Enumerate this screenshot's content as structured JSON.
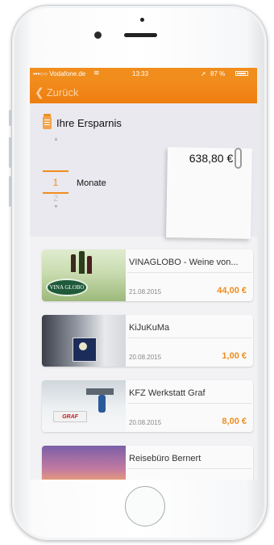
{
  "statusbar": {
    "carrier": "•••○○ Vodafone.de",
    "wifi_icon": "wifi-icon",
    "time": "13:33",
    "battery": "87 %"
  },
  "navbar": {
    "back_label": "Zurück"
  },
  "savings": {
    "title": "Ihre Ersparnis",
    "picker_selected": "1",
    "picker_next": "2",
    "unit_label": "Monate",
    "amount": "638,80 €"
  },
  "items": [
    {
      "title": "VINAGLOBO - Weine von...",
      "date": "21.08.2015",
      "price": "44,00 €",
      "logo_text": "VINA GLOBO"
    },
    {
      "title": "KiJuKuMa",
      "date": "20.08.2015",
      "price": "1,00 €"
    },
    {
      "title": "KFZ Werkstatt Graf",
      "date": "20.08.2015",
      "price": "8,00 €",
      "logo_text": "GRAF"
    },
    {
      "title": "Reisebüro Bernert"
    }
  ],
  "colors": {
    "accent": "#f08d1d"
  }
}
